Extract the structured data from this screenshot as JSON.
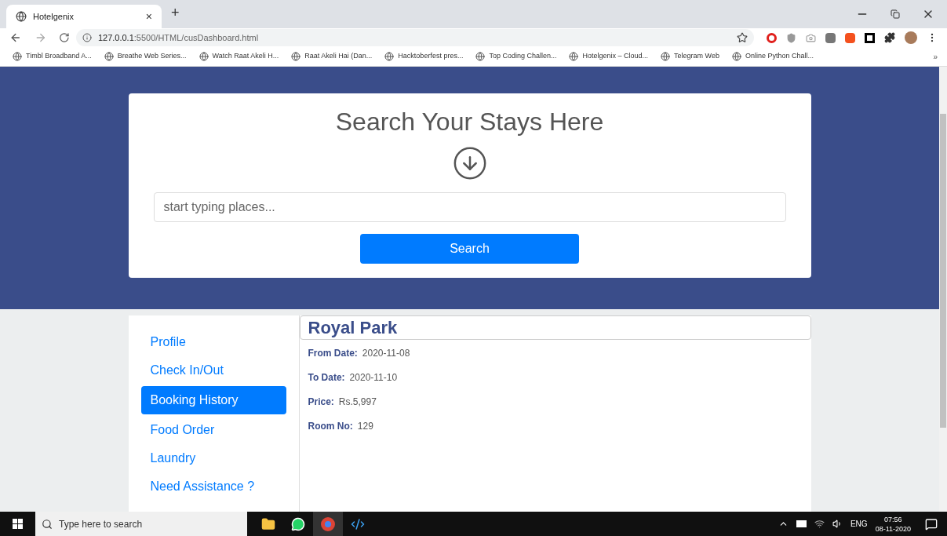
{
  "browser": {
    "tab": {
      "title": "Hotelgenix",
      "close": "×",
      "new": "+"
    },
    "url_host": "127.0.0.1",
    "url_path": ":5500/HTML/cusDashboard.html",
    "bookmarks": [
      "Timbl Broadband A...",
      "Breathe Web Series...",
      "Watch Raat Akeli H...",
      "Raat Akeli Hai (Dan...",
      "Hacktoberfest pres...",
      "Top Coding Challen...",
      "Hotelgenix – Cloud...",
      "Telegram Web",
      "Online Python Chall..."
    ],
    "more": "»"
  },
  "search_card": {
    "title": "Search Your Stays Here",
    "placeholder": "start typing places...",
    "button": "Search"
  },
  "sidebar": {
    "items": [
      {
        "label": "Profile",
        "selected": false
      },
      {
        "label": "Check In/Out",
        "selected": false
      },
      {
        "label": "Booking History",
        "selected": true
      },
      {
        "label": "Food Order",
        "selected": false
      },
      {
        "label": "Laundry",
        "selected": false
      },
      {
        "label": "Need Assistance ?",
        "selected": false
      }
    ]
  },
  "booking": {
    "hotel": "Royal Park",
    "fields": [
      {
        "label": "From Date:",
        "value": "2020-11-08"
      },
      {
        "label": "To Date:",
        "value": "2020-11-10"
      },
      {
        "label": "Price:",
        "value": "Rs.5,997"
      },
      {
        "label": "Room No:",
        "value": "129"
      }
    ]
  },
  "taskbar": {
    "search_placeholder": "Type here to search",
    "language": "ENG",
    "time": "07:56",
    "date": "08-11-2020"
  }
}
